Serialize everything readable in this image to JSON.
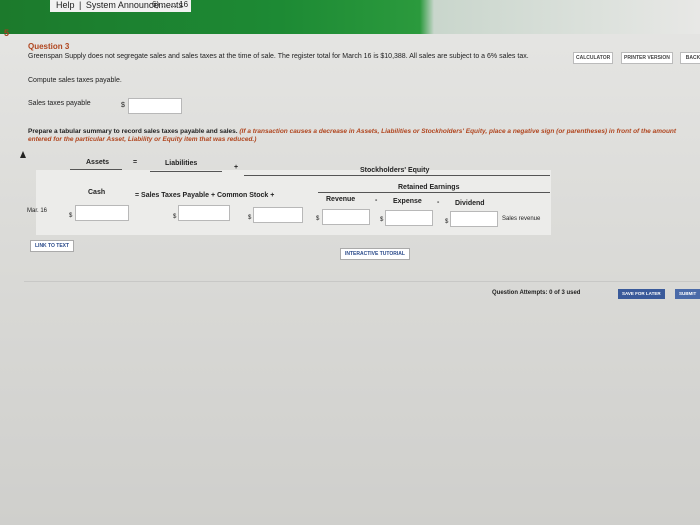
{
  "topbar": {
    "links": [
      "Help",
      "System Announcements"
    ],
    "trail": "6) ... ... 16"
  },
  "left_number": "5",
  "toolbar": {
    "calculator": "CALCULATOR",
    "printer": "PRINTER VERSION",
    "back": "BACK"
  },
  "question": {
    "title": "Question 3",
    "text": "Greenspan Supply does not segregate sales and sales taxes at the time of sale. The register total for March 16 is $10,388. All sales are subject to a 6% sales tax.",
    "instruction": "Compute sales taxes payable.",
    "sales_tax_label": "Sales taxes payable",
    "dollar": "$"
  },
  "prepare": {
    "lead": "Prepare a tabular summary to record sales taxes payable and sales.",
    "red": "(If a transaction causes a decrease in Assets, Liabilities or Stockholders' Equity, place a negative sign (or parentheses) in front of the amount entered for the particular Asset, Liability or Equity item that was reduced.)"
  },
  "table": {
    "assets": "Assets",
    "eq": "=",
    "liabilities": "Liabilities",
    "plus": "+",
    "stockholders_equity": "Stockholders' Equity",
    "retained_earnings": "Retained Earnings",
    "cash": "Cash",
    "eq_sales": "= Sales Taxes Payable + Common Stock +",
    "revenue": "Revenue",
    "minus1": "-",
    "expense": "Expense",
    "minus2": "-",
    "dividend": "Dividend",
    "row_date": "Mar. 16",
    "row_note": "Sales revenue",
    "dollar": "$"
  },
  "buttons": {
    "link_to_text": "LINK TO TEXT",
    "interactive_tutorial": "INTERACTIVE TUTORIAL",
    "save_for_later": "SAVE FOR LATER",
    "submit": "SUBMIT"
  },
  "attempts": "Question Attempts: 0 of 3 used"
}
